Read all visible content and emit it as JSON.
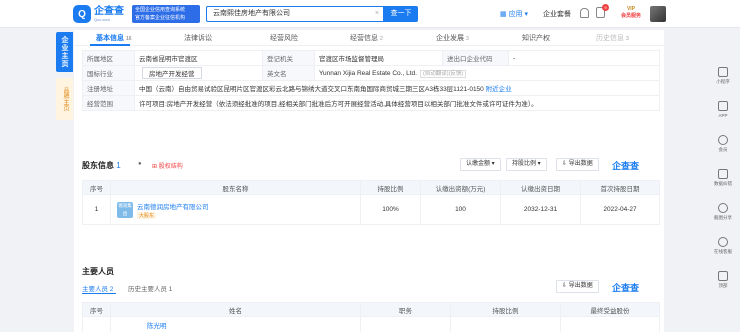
{
  "header": {
    "logo_text": "企查查",
    "logo_sub": "Qcc.com",
    "ad_lines": [
      "全国企业信用查询系统",
      "官方备案企业征信机构"
    ],
    "search_value": "云南熙佳房地产有限公司",
    "search_button": "查一下",
    "app_label": "应用",
    "enterprise_label": "企业套餐",
    "message_badge": "9",
    "vip_label": "VIP",
    "vip_sub": "会员服务"
  },
  "side_tabs": {
    "main": "企业主页",
    "brand": "品牌主页"
  },
  "tabs": [
    {
      "label": "基本信息",
      "count": "16"
    },
    {
      "label": "法律诉讼",
      "count": ""
    },
    {
      "label": "经营风险",
      "count": ""
    },
    {
      "label": "经营信息",
      "count": "2"
    },
    {
      "label": "企业发展",
      "count": "3"
    },
    {
      "label": "知识产权",
      "count": ""
    },
    {
      "label": "历史信息",
      "count": "3"
    }
  ],
  "basic_info": {
    "region_label": "所属地区",
    "region_value": "云南省昆明市官渡区",
    "reg_org_label": "登记机关",
    "reg_org_value": "官渡区市场监督管理局",
    "ie_code_label": "进出口企业代码",
    "ie_code_value": "-",
    "industry_label": "国标行业",
    "industry_value": "房地产开发经营",
    "en_name_label": "英文名",
    "en_name_value": "Yunnan Xijia Real Estate Co., Ltd.",
    "en_name_note": "(自动翻译)(反馈)",
    "address_label": "注册地址",
    "address_value": "中国（云南）自由贸易试验区昆明片区官渡区彩云北路与锦绣大道交叉口东南角国际商贸城三期三区A3栋33层1121-0150",
    "address_link": "附近企业",
    "scope_label": "经营范围",
    "scope_value": "许可项目:房地产开发经营（依法须经批准的项目,经相关部门批准后方可开展经营活动,具体经营项目以相关部门批准文件或许可证件为准）。"
  },
  "shareholders": {
    "title": "股东信息",
    "count": "1",
    "structure_link": "股权结构",
    "paid_btn": "认缴金额",
    "ratio_btn": "持股比例",
    "export_btn": "导出数据",
    "brand": "企查查",
    "columns": [
      "序号",
      "股东名称",
      "持股比例",
      "认缴出资额(万元)",
      "认缴出资日期",
      "首次持股日期"
    ],
    "rows": [
      {
        "index": "1",
        "logo_text": "德润集团",
        "name": "云南德润房地产有限公司",
        "tag": "大股东",
        "ratio": "100%",
        "amount": "100",
        "paid_date": "2032-12-31",
        "first_date": "2022-04-27"
      }
    ]
  },
  "personnel": {
    "title": "主要人员",
    "tab_current": "主要人员 2",
    "tab_history": "历史主要人员 1",
    "export_btn": "导出数据",
    "brand": "企查查",
    "columns": [
      "序号",
      "姓名",
      "职务",
      "持股比例",
      "最终受益股份"
    ],
    "first_name": "陈光明"
  },
  "right_bar": [
    "小程序",
    "APP",
    "会员",
    "数据纠错",
    "截图分享",
    "在线客服",
    "顶部"
  ]
}
